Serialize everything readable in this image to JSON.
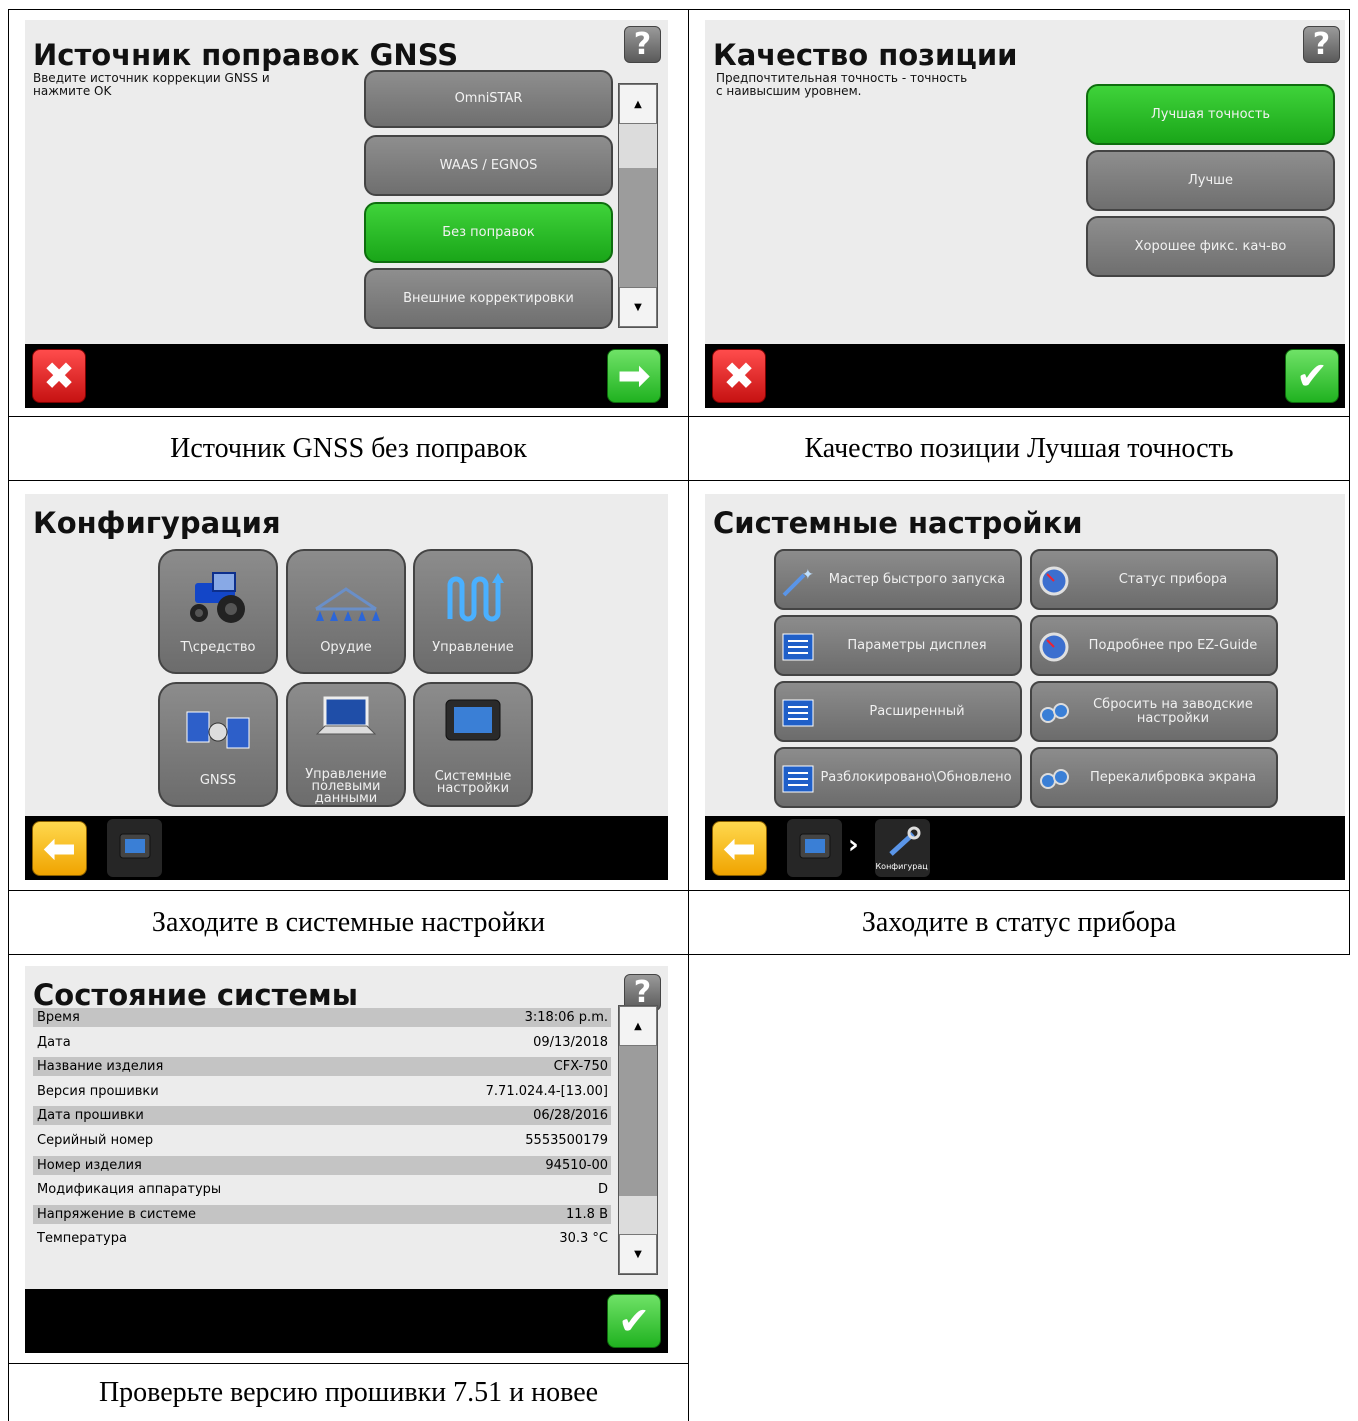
{
  "panel1": {
    "title": "Источник поправок GNSS",
    "help": "?",
    "description": "Введите источник коррекции GNSS и\nнажмите OK",
    "options": [
      "OmniSTAR",
      "WAAS / EGNOS",
      "Без поправок",
      "Внешние корректировки"
    ],
    "selected": "Без поправок",
    "caption": "Источник GNSS без поправок"
  },
  "panel2": {
    "title": "Качество позиции",
    "help": "?",
    "description": "Предпочтительная точность - точность\nс наивысшим уровнем.",
    "options": [
      "Лучшая точность",
      "Лучше",
      "Хорошее фикс. кач-во"
    ],
    "selected": "Лучшая точность",
    "caption": "Качество позиции Лучшая точность"
  },
  "panel3": {
    "title": "Конфигурация",
    "tiles": [
      "Т\\средство",
      "Орудие",
      "Управление",
      "GNSS",
      "Управление\nполевыми\nданными",
      "Системные\nнастройки"
    ],
    "caption": "Заходите в системные настройки"
  },
  "panel4": {
    "title": "Системные настройки",
    "buttons": [
      "Мастер быстрого запуска",
      "Статус прибора",
      "Параметры дисплея",
      "Подробнее про EZ-Guide",
      "Расширенный",
      "Сбросить на заводские настройки",
      "Разблокировано\\Обновлено",
      "Перекалибровка экрана"
    ],
    "breadcrumb_label": "Конфигурац",
    "caption": "Заходите в статус прибора"
  },
  "panel5": {
    "title": "Состояние системы",
    "help": "?",
    "rows": [
      {
        "label": "Время",
        "value": "3:18:06 p.m."
      },
      {
        "label": "Дата",
        "value": "09/13/2018"
      },
      {
        "label": "Название изделия",
        "value": "CFX-750"
      },
      {
        "label": "Версия прошивки",
        "value": "7.71.024.4-[13.00]"
      },
      {
        "label": "Дата прошивки",
        "value": "06/28/2016"
      },
      {
        "label": "Серийный номер",
        "value": "5553500179"
      },
      {
        "label": "Номер изделия",
        "value": "94510-00"
      },
      {
        "label": "Модификация аппаратуры",
        "value": "D"
      },
      {
        "label": "Напряжение в системе",
        "value": "11.8 В"
      },
      {
        "label": "Температура",
        "value": "30.3 °C"
      }
    ],
    "caption": "Проверьте версию прошивки 7.51 и новее"
  },
  "colors": {
    "green": "#22b420",
    "red": "#d61a1a",
    "yellow": "#f5b400",
    "screen": "#ececec",
    "button": "#7c7c7c"
  },
  "icons": [
    "help-icon",
    "cancel-icon",
    "next-arrow-icon",
    "check-icon",
    "back-arrow-icon",
    "tractor-icon",
    "boom-icon",
    "steering-icon",
    "satellite-icon",
    "laptop-icon",
    "display-icon",
    "wand-icon",
    "gauge-icon",
    "list-icon",
    "gears-icon",
    "wrench-icon"
  ]
}
